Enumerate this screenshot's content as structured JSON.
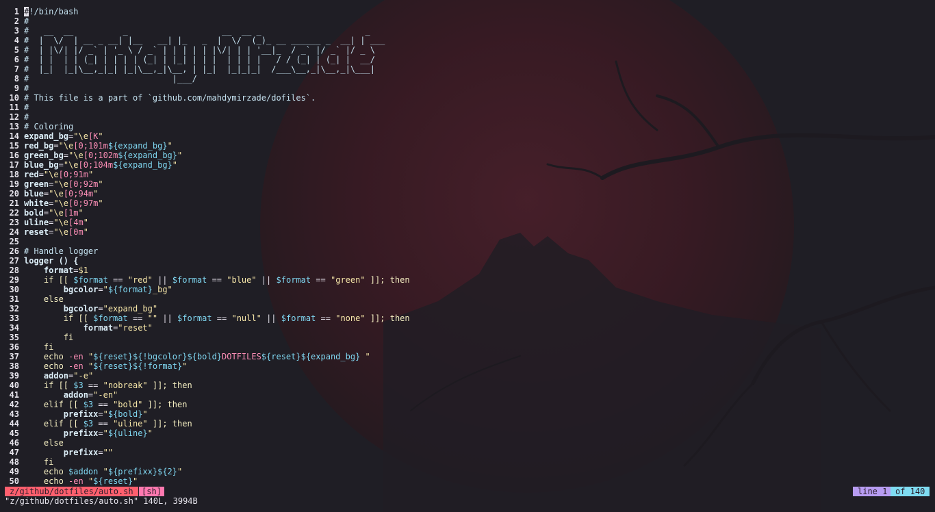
{
  "colors": {
    "background": "#1f1e25",
    "moon": "#3a1c24",
    "statusline_file_bg": "#ff5f6e",
    "statusline_filetype_bg": "#ff79b0",
    "statusline_line_bg": "#b79cf2",
    "statusline_of_bg": "#7fdcf2"
  },
  "editor": {
    "lines": [
      {
        "n": "1",
        "tokens": [
          {
            "t": "#",
            "c": "cursor"
          },
          {
            "t": "!/bin/bash",
            "c": "c"
          }
        ]
      },
      {
        "n": "2",
        "tokens": [
          {
            "t": "#",
            "c": "c"
          }
        ]
      },
      {
        "n": "3",
        "tokens": [
          {
            "t": "#   __  __          _                   __  __ _                     _",
            "c": "c"
          }
        ]
      },
      {
        "n": "4",
        "tokens": [
          {
            "t": "#  |  \\/  | __ _ __| |__   __| |_   _  |  \\/  (_)_ __ ______ _  __| | ___",
            "c": "c"
          }
        ]
      },
      {
        "n": "5",
        "tokens": [
          {
            "t": "#  | |\\/| |/ _` | '_ \\ / _` | | | | | |\\/| | | '__|_  / _` |/ _` |/ _ \\",
            "c": "c"
          }
        ]
      },
      {
        "n": "6",
        "tokens": [
          {
            "t": "#  | |  | | (_| | | | | (_| | |_| | | |  | | | |   / / (_| | (_| |  __/",
            "c": "c"
          }
        ]
      },
      {
        "n": "7",
        "tokens": [
          {
            "t": "#  |_|  |_|\\__,_|_| |_|\\__,_|\\__, | |_|  |_|_|_|  /___\\__,_|\\__,_|\\___|",
            "c": "c"
          }
        ]
      },
      {
        "n": "8",
        "tokens": [
          {
            "t": "#                             |___/",
            "c": "c"
          }
        ]
      },
      {
        "n": "9",
        "tokens": [
          {
            "t": "#",
            "c": "c"
          }
        ]
      },
      {
        "n": "10",
        "tokens": [
          {
            "t": "# This file is a part of `github.com/mahdymirzade/dofiles`.",
            "c": "c"
          }
        ]
      },
      {
        "n": "11",
        "tokens": [
          {
            "t": "#",
            "c": "c"
          }
        ]
      },
      {
        "n": "12",
        "tokens": [
          {
            "t": "#",
            "c": "c"
          }
        ]
      },
      {
        "n": "13",
        "tokens": [
          {
            "t": "# Coloring",
            "c": "c"
          }
        ]
      },
      {
        "n": "14",
        "tokens": [
          {
            "t": "expand_bg",
            "c": "var"
          },
          {
            "t": "=",
            "c": "op"
          },
          {
            "t": "\"\\e",
            "c": "s"
          },
          {
            "t": "[K",
            "c": "e"
          },
          {
            "t": "\"",
            "c": "s"
          }
        ]
      },
      {
        "n": "15",
        "tokens": [
          {
            "t": "red_bg",
            "c": "var"
          },
          {
            "t": "=",
            "c": "op"
          },
          {
            "t": "\"\\e",
            "c": "s"
          },
          {
            "t": "[0;101m",
            "c": "e"
          },
          {
            "t": "${expand_bg}",
            "c": "x"
          },
          {
            "t": "\"",
            "c": "s"
          }
        ]
      },
      {
        "n": "16",
        "tokens": [
          {
            "t": "green_bg",
            "c": "var"
          },
          {
            "t": "=",
            "c": "op"
          },
          {
            "t": "\"\\e",
            "c": "s"
          },
          {
            "t": "[0;102m",
            "c": "e"
          },
          {
            "t": "${expand_bg}",
            "c": "x"
          },
          {
            "t": "\"",
            "c": "s"
          }
        ]
      },
      {
        "n": "17",
        "tokens": [
          {
            "t": "blue_bg",
            "c": "var"
          },
          {
            "t": "=",
            "c": "op"
          },
          {
            "t": "\"\\e",
            "c": "s"
          },
          {
            "t": "[0;104m",
            "c": "e"
          },
          {
            "t": "${expand_bg}",
            "c": "x"
          },
          {
            "t": "\"",
            "c": "s"
          }
        ]
      },
      {
        "n": "18",
        "tokens": [
          {
            "t": "red",
            "c": "var"
          },
          {
            "t": "=",
            "c": "op"
          },
          {
            "t": "\"\\e",
            "c": "s"
          },
          {
            "t": "[0;91m",
            "c": "e"
          },
          {
            "t": "\"",
            "c": "s"
          }
        ]
      },
      {
        "n": "19",
        "tokens": [
          {
            "t": "green",
            "c": "var"
          },
          {
            "t": "=",
            "c": "op"
          },
          {
            "t": "\"\\e",
            "c": "s"
          },
          {
            "t": "[0;92m",
            "c": "e"
          },
          {
            "t": "\"",
            "c": "s"
          }
        ]
      },
      {
        "n": "20",
        "tokens": [
          {
            "t": "blue",
            "c": "var"
          },
          {
            "t": "=",
            "c": "op"
          },
          {
            "t": "\"\\e",
            "c": "s"
          },
          {
            "t": "[0;94m",
            "c": "e"
          },
          {
            "t": "\"",
            "c": "s"
          }
        ]
      },
      {
        "n": "21",
        "tokens": [
          {
            "t": "white",
            "c": "var"
          },
          {
            "t": "=",
            "c": "op"
          },
          {
            "t": "\"\\e",
            "c": "s"
          },
          {
            "t": "[0;97m",
            "c": "e"
          },
          {
            "t": "\"",
            "c": "s"
          }
        ]
      },
      {
        "n": "22",
        "tokens": [
          {
            "t": "bold",
            "c": "var"
          },
          {
            "t": "=",
            "c": "op"
          },
          {
            "t": "\"\\e",
            "c": "s"
          },
          {
            "t": "[1m",
            "c": "e"
          },
          {
            "t": "\"",
            "c": "s"
          }
        ]
      },
      {
        "n": "23",
        "tokens": [
          {
            "t": "uline",
            "c": "var"
          },
          {
            "t": "=",
            "c": "op"
          },
          {
            "t": "\"\\e",
            "c": "s"
          },
          {
            "t": "[4m",
            "c": "e"
          },
          {
            "t": "\"",
            "c": "s"
          }
        ]
      },
      {
        "n": "24",
        "tokens": [
          {
            "t": "reset",
            "c": "var"
          },
          {
            "t": "=",
            "c": "op"
          },
          {
            "t": "\"\\e",
            "c": "s"
          },
          {
            "t": "[0m",
            "c": "e"
          },
          {
            "t": "\"",
            "c": "s"
          }
        ]
      },
      {
        "n": "25",
        "tokens": []
      },
      {
        "n": "26",
        "tokens": [
          {
            "t": "# Handle logger",
            "c": "c"
          }
        ]
      },
      {
        "n": "27",
        "tokens": [
          {
            "t": "logger () {",
            "c": "fn"
          }
        ]
      },
      {
        "n": "28",
        "tokens": [
          {
            "t": "    ",
            "c": "op"
          },
          {
            "t": "format",
            "c": "var"
          },
          {
            "t": "=",
            "c": "op"
          },
          {
            "t": "$1",
            "c": "s"
          }
        ]
      },
      {
        "n": "29",
        "tokens": [
          {
            "t": "    if [[ ",
            "c": "k"
          },
          {
            "t": "$format",
            "c": "x"
          },
          {
            "t": " == ",
            "c": "op"
          },
          {
            "t": "\"red\"",
            "c": "s"
          },
          {
            "t": " || ",
            "c": "op"
          },
          {
            "t": "$format",
            "c": "x"
          },
          {
            "t": " == ",
            "c": "op"
          },
          {
            "t": "\"blue\"",
            "c": "s"
          },
          {
            "t": " || ",
            "c": "op"
          },
          {
            "t": "$format",
            "c": "x"
          },
          {
            "t": " == ",
            "c": "op"
          },
          {
            "t": "\"green\"",
            "c": "s"
          },
          {
            "t": " ]]; then",
            "c": "k"
          }
        ]
      },
      {
        "n": "30",
        "tokens": [
          {
            "t": "        ",
            "c": "op"
          },
          {
            "t": "bgcolor",
            "c": "var"
          },
          {
            "t": "=",
            "c": "op"
          },
          {
            "t": "\"",
            "c": "s"
          },
          {
            "t": "${format}",
            "c": "x"
          },
          {
            "t": "_bg\"",
            "c": "s"
          }
        ]
      },
      {
        "n": "31",
        "tokens": [
          {
            "t": "    else",
            "c": "k"
          }
        ]
      },
      {
        "n": "32",
        "tokens": [
          {
            "t": "        ",
            "c": "op"
          },
          {
            "t": "bgcolor",
            "c": "var"
          },
          {
            "t": "=",
            "c": "op"
          },
          {
            "t": "\"expand_bg\"",
            "c": "s"
          }
        ]
      },
      {
        "n": "33",
        "tokens": [
          {
            "t": "        if [[ ",
            "c": "k"
          },
          {
            "t": "$format",
            "c": "x"
          },
          {
            "t": " == ",
            "c": "op"
          },
          {
            "t": "\"\"",
            "c": "s"
          },
          {
            "t": " || ",
            "c": "op"
          },
          {
            "t": "$format",
            "c": "x"
          },
          {
            "t": " == ",
            "c": "op"
          },
          {
            "t": "\"null\"",
            "c": "s"
          },
          {
            "t": " || ",
            "c": "op"
          },
          {
            "t": "$format",
            "c": "x"
          },
          {
            "t": " == ",
            "c": "op"
          },
          {
            "t": "\"none\"",
            "c": "s"
          },
          {
            "t": " ]]; then",
            "c": "k"
          }
        ]
      },
      {
        "n": "34",
        "tokens": [
          {
            "t": "            ",
            "c": "op"
          },
          {
            "t": "format",
            "c": "var"
          },
          {
            "t": "=",
            "c": "op"
          },
          {
            "t": "\"reset\"",
            "c": "s"
          }
        ]
      },
      {
        "n": "35",
        "tokens": [
          {
            "t": "        fi",
            "c": "k"
          }
        ]
      },
      {
        "n": "36",
        "tokens": [
          {
            "t": "    fi",
            "c": "k"
          }
        ]
      },
      {
        "n": "37",
        "tokens": [
          {
            "t": "    echo ",
            "c": "k"
          },
          {
            "t": "-en ",
            "c": "e"
          },
          {
            "t": "\"",
            "c": "s"
          },
          {
            "t": "${reset}${!bgcolor}${bold}",
            "c": "x"
          },
          {
            "t": "DOTFILES",
            "c": "e"
          },
          {
            "t": "${reset}${expand_bg}",
            "c": "x"
          },
          {
            "t": " \"",
            "c": "s"
          }
        ]
      },
      {
        "n": "38",
        "tokens": [
          {
            "t": "    echo ",
            "c": "k"
          },
          {
            "t": "-en ",
            "c": "e"
          },
          {
            "t": "\"",
            "c": "s"
          },
          {
            "t": "${reset}${!format}",
            "c": "x"
          },
          {
            "t": "\"",
            "c": "s"
          }
        ]
      },
      {
        "n": "39",
        "tokens": [
          {
            "t": "    ",
            "c": "op"
          },
          {
            "t": "addon",
            "c": "var"
          },
          {
            "t": "=",
            "c": "op"
          },
          {
            "t": "\"-e\"",
            "c": "s"
          }
        ]
      },
      {
        "n": "40",
        "tokens": [
          {
            "t": "    if [[ ",
            "c": "k"
          },
          {
            "t": "$3",
            "c": "x"
          },
          {
            "t": " == ",
            "c": "op"
          },
          {
            "t": "\"nobreak\"",
            "c": "s"
          },
          {
            "t": " ]]; then",
            "c": "k"
          }
        ]
      },
      {
        "n": "41",
        "tokens": [
          {
            "t": "        ",
            "c": "op"
          },
          {
            "t": "addon",
            "c": "var"
          },
          {
            "t": "=",
            "c": "op"
          },
          {
            "t": "\"-en\"",
            "c": "s"
          }
        ]
      },
      {
        "n": "42",
        "tokens": [
          {
            "t": "    elif [[ ",
            "c": "k"
          },
          {
            "t": "$3",
            "c": "x"
          },
          {
            "t": " == ",
            "c": "op"
          },
          {
            "t": "\"bold\"",
            "c": "s"
          },
          {
            "t": " ]]; then",
            "c": "k"
          }
        ]
      },
      {
        "n": "43",
        "tokens": [
          {
            "t": "        ",
            "c": "op"
          },
          {
            "t": "prefixx",
            "c": "var"
          },
          {
            "t": "=",
            "c": "op"
          },
          {
            "t": "\"",
            "c": "s"
          },
          {
            "t": "${bold}",
            "c": "x"
          },
          {
            "t": "\"",
            "c": "s"
          }
        ]
      },
      {
        "n": "44",
        "tokens": [
          {
            "t": "    elif [[ ",
            "c": "k"
          },
          {
            "t": "$3",
            "c": "x"
          },
          {
            "t": " == ",
            "c": "op"
          },
          {
            "t": "\"uline\"",
            "c": "s"
          },
          {
            "t": " ]]; then",
            "c": "k"
          }
        ]
      },
      {
        "n": "45",
        "tokens": [
          {
            "t": "        ",
            "c": "op"
          },
          {
            "t": "prefixx",
            "c": "var"
          },
          {
            "t": "=",
            "c": "op"
          },
          {
            "t": "\"",
            "c": "s"
          },
          {
            "t": "${uline}",
            "c": "x"
          },
          {
            "t": "\"",
            "c": "s"
          }
        ]
      },
      {
        "n": "46",
        "tokens": [
          {
            "t": "    else",
            "c": "k"
          }
        ]
      },
      {
        "n": "47",
        "tokens": [
          {
            "t": "        ",
            "c": "op"
          },
          {
            "t": "prefixx",
            "c": "var"
          },
          {
            "t": "=",
            "c": "op"
          },
          {
            "t": "\"\"",
            "c": "s"
          }
        ]
      },
      {
        "n": "48",
        "tokens": [
          {
            "t": "    fi",
            "c": "k"
          }
        ]
      },
      {
        "n": "49",
        "tokens": [
          {
            "t": "    echo ",
            "c": "k"
          },
          {
            "t": "$addon",
            "c": "x"
          },
          {
            "t": " \"",
            "c": "s"
          },
          {
            "t": "${prefixx}${2}",
            "c": "x"
          },
          {
            "t": "\"",
            "c": "s"
          }
        ]
      },
      {
        "n": "50",
        "tokens": [
          {
            "t": "    echo ",
            "c": "k"
          },
          {
            "t": "-en ",
            "c": "e"
          },
          {
            "t": "\"",
            "c": "s"
          },
          {
            "t": "${reset}",
            "c": "x"
          },
          {
            "t": "\"",
            "c": "s"
          }
        ]
      }
    ]
  },
  "statusline": {
    "file": "z/github/dotfiles/auto.sh",
    "filetype": "[sh]",
    "line": "line 1",
    "of": "of 140"
  },
  "cmdline": {
    "text": "\"z/github/dotfiles/auto.sh\" 140L, 3994B"
  }
}
